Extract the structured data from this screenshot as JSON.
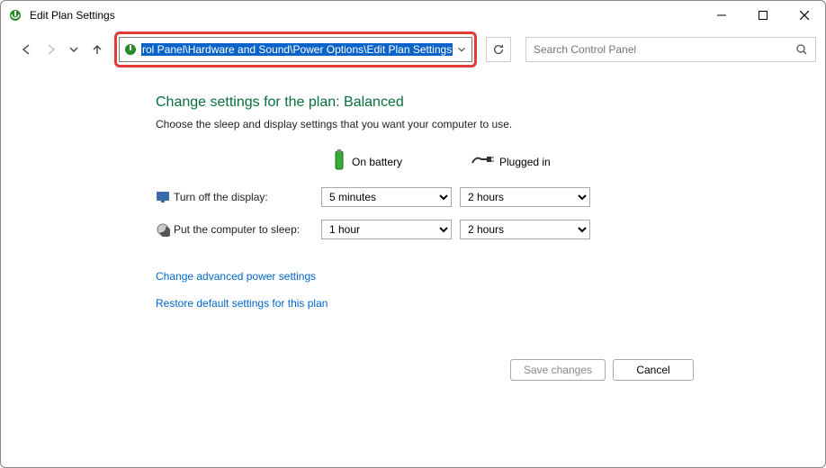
{
  "window": {
    "title": "Edit Plan Settings"
  },
  "breadcrumb": {
    "path": "rol Panel\\Hardware and Sound\\Power Options\\Edit Plan Settings"
  },
  "search": {
    "placeholder": "Search Control Panel"
  },
  "page": {
    "heading": "Change settings for the plan: Balanced",
    "subheading": "Choose the sleep and display settings that you want your computer to use.",
    "columns": {
      "battery": "On battery",
      "plugged": "Plugged in"
    },
    "rows": {
      "display": {
        "label": "Turn off the display:",
        "battery": "5 minutes",
        "plugged": "2 hours"
      },
      "sleep": {
        "label": "Put the computer to sleep:",
        "battery": "1 hour",
        "plugged": "2 hours"
      }
    },
    "links": {
      "advanced": "Change advanced power settings",
      "restore": "Restore default settings for this plan"
    },
    "buttons": {
      "save": "Save changes",
      "cancel": "Cancel"
    }
  }
}
